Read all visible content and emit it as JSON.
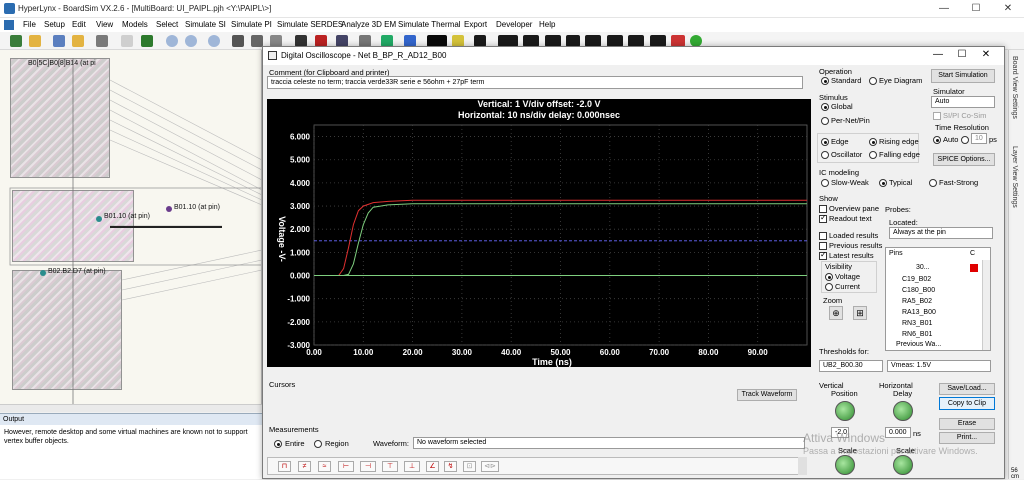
{
  "app": {
    "title": "HyperLynx - BoardSim VX.2.6 - [MultiBoard: UI_PAIPL.pjh <Y:\\PAIPL\\>]",
    "min_btn": "—",
    "max_btn": "☐",
    "close_btn": "✕"
  },
  "menu": [
    "File",
    "Setup",
    "Edit",
    "View",
    "Models",
    "Select",
    "Simulate SI",
    "Simulate PI",
    "Simulate SERDES",
    "Analyze 3D EM",
    "Simulate Thermal",
    "Export",
    "Developer",
    "Help"
  ],
  "board_labels": {
    "b1": "B0[5C]B0[8]B14 (at pi",
    "b2": "B01.10 (at pin)",
    "b3": "B01.10 (at pin)",
    "b4": "B02.B2.D7 (at pin)"
  },
  "output": {
    "header": "Output",
    "text": "However, remote desktop and some virtual machines are known not to support vertex buffer objects."
  },
  "right_tabs": [
    "Board View Settings",
    "Layer View Settings"
  ],
  "dialog": {
    "title": "Digital Oscilloscope - Net B_BP_R_AD12_B00",
    "min_btn": "—",
    "max_btn": "☐",
    "close_btn": "✕",
    "comment_label": "Comment (for Clipboard and printer)",
    "comment_value": "traccia celeste no term; traccia verde33R serie e 56ohm + 27pF term",
    "cursors_label": "Cursors",
    "track_waveform": "Track Waveform",
    "measurements_label": "Measurements",
    "entire": "Entire",
    "region": "Region",
    "waveform_label": "Waveform:",
    "waveform_value": "No waveform selected"
  },
  "scope": {
    "header_line1": "Vertical: 1  V/div  offset: -2.0 V",
    "header_line2": "Horizontal: 10 ns/div  delay: 0.000nsec",
    "y_axis_label": "Voltage  -V-",
    "x_axis_label": "Time  (ns)",
    "y_ticks": [
      "6.000",
      "5.000",
      "4.000",
      "3.000",
      "2.000",
      "1.000",
      "0.000",
      "-1.000",
      "-2.000",
      "-3.000"
    ],
    "x_ticks": [
      "0.00",
      "10.00",
      "20.00",
      "30.00",
      "40.00",
      "50.00",
      "60.00",
      "70.00",
      "80.00",
      "90.00"
    ]
  },
  "chart_data": {
    "type": "line",
    "title": "",
    "xlabel": "Time  (ns)",
    "ylabel": "Voltage  -V-",
    "xlim": [
      0,
      100
    ],
    "ylim": [
      -3,
      6.5
    ],
    "grid": true,
    "threshold_line": 1.5,
    "series": [
      {
        "color": "#e03030",
        "x": [
          0,
          5,
          6,
          7,
          8,
          9,
          10,
          12,
          15,
          20,
          30,
          50,
          100
        ],
        "values": [
          0,
          0,
          0.3,
          1.2,
          2.2,
          2.8,
          3.0,
          3.15,
          3.2,
          3.25,
          3.25,
          3.25,
          3.25
        ]
      },
      {
        "color": "#7fcf7f",
        "x": [
          0,
          6,
          7,
          8,
          9,
          10,
          11,
          12,
          15,
          20,
          30,
          50,
          100
        ],
        "values": [
          0,
          0,
          0.05,
          0.5,
          1.4,
          2.2,
          2.7,
          2.95,
          3.05,
          3.1,
          3.1,
          3.1,
          3.1
        ]
      },
      {
        "color": "#7fcf7f",
        "x": [
          0,
          100
        ],
        "values": [
          0,
          0
        ]
      }
    ]
  },
  "operation": {
    "label": "Operation",
    "standard": "Standard",
    "eye": "Eye Diagram",
    "start_sim": "Start Simulation"
  },
  "stimulus": {
    "label": "Stimulus",
    "global": "Global",
    "per_net": "Per-Net/Pin",
    "edge": "Edge",
    "oscillator": "Oscillator",
    "rising": "Rising edge",
    "falling": "Falling edge"
  },
  "simulator": {
    "label": "Simulator",
    "value": "Auto",
    "cosim": "SI/PI Co-Sim",
    "time_res": "Time Resolution",
    "auto": "Auto",
    "auto_val": "10",
    "ps": "ps",
    "spice": "SPICE Options..."
  },
  "ic_modeling": {
    "label": "IC modeling",
    "slow": "Slow-Weak",
    "typical": "Typical",
    "fast": "Fast-Strong"
  },
  "show": {
    "label": "Show",
    "overview": "Overview pane",
    "readout": "Readout text",
    "loaded": "Loaded results",
    "previous": "Previous results",
    "latest": "Latest results",
    "visibility": "Visibility",
    "voltage": "Voltage",
    "current": "Current",
    "zoom": "Zoom"
  },
  "probes": {
    "label": "Probes:",
    "located": "Located:",
    "located_value": "Always at the pin",
    "pins_header": "Pins",
    "c_header": "C",
    "pins": [
      "30...",
      "C19_B02",
      "C180_B00",
      "RA5_B02",
      "RA13_B00",
      "RN3_B01",
      "RN6_B01",
      "Previous Wa..."
    ]
  },
  "thresholds": {
    "label": "Thresholds for:",
    "value": "UB2_B00.30",
    "vmeas": "Vmeas: 1.5V"
  },
  "vertical": {
    "label": "Vertical",
    "position": "Position",
    "value": "-2.0",
    "scale": "Scale"
  },
  "horizontal": {
    "label": "Horizontal",
    "delay": "Delay",
    "value": "0.000",
    "unit": "ns",
    "scale": "Scale"
  },
  "side_buttons": [
    "Save/Load...",
    "Copy to Clip",
    "Erase",
    "Print..."
  ],
  "watermark": [
    "Attiva Windows",
    "Passa a Impostazioni per attivare Windows."
  ],
  "status_right": "56 cm"
}
